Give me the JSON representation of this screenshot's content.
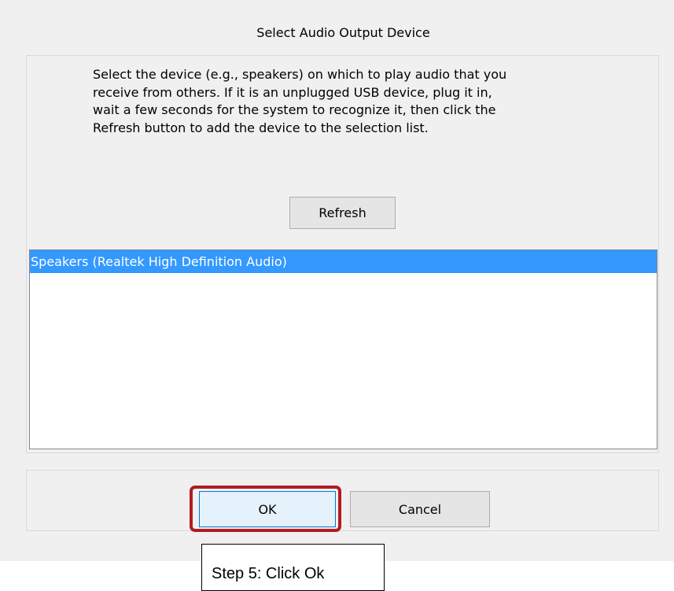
{
  "dialog": {
    "title": "Select Audio Output Device",
    "description": "Select the device (e.g., speakers) on which to play audio that you\nreceive from others. If it is an unplugged USB device, plug it in,\nwait a few seconds for the system to recognize it, then click the\nRefresh button to add the device to the selection list.",
    "refresh_label": "Refresh",
    "devices": [
      {
        "label": "Speakers (Realtek High Definition Audio)",
        "selected": true
      }
    ],
    "ok_label": "OK",
    "cancel_label": "Cancel"
  },
  "annotation": {
    "callout_text": "Step 5: Click Ok",
    "highlight_color": "#b01c23"
  },
  "colors": {
    "selection": "#3399ff",
    "dialog_bg": "#f0f0f0"
  }
}
